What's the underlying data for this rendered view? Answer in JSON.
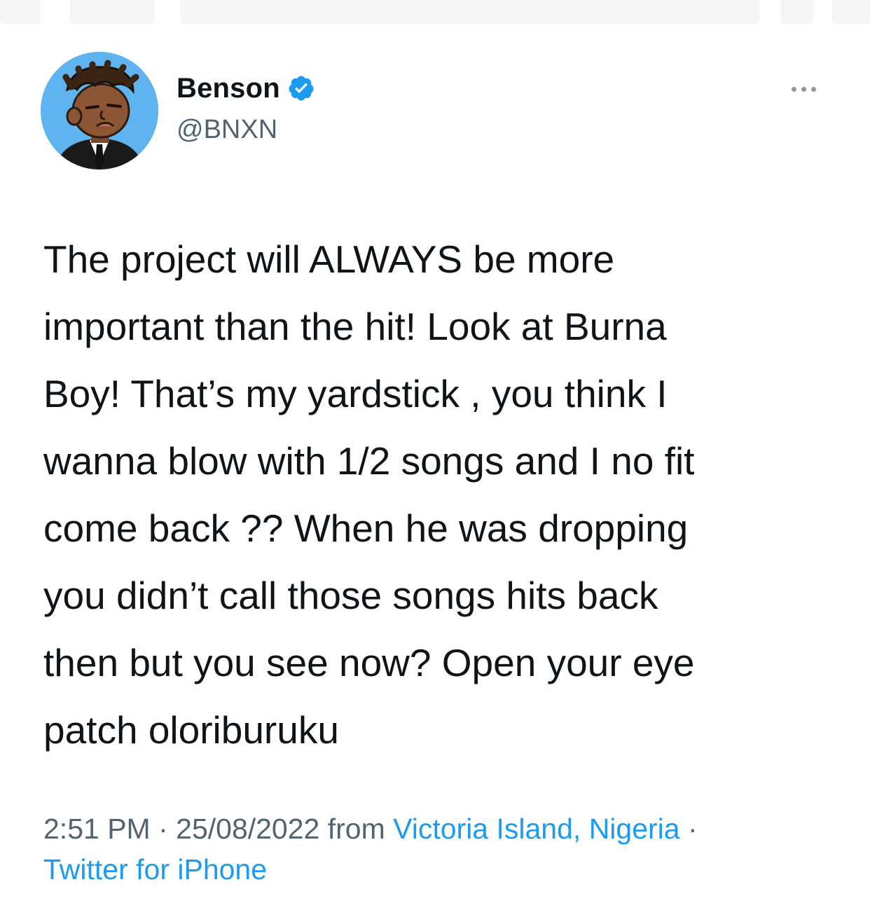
{
  "colors": {
    "text_primary": "#0f1419",
    "text_secondary": "#536471",
    "link": "#1d9bf0",
    "verified": "#1d9bf0",
    "avatar_bg": "#5fb3ee"
  },
  "user": {
    "display_name": "Benson",
    "handle": "@BNXN",
    "verified_icon": "verified-badge-icon",
    "avatar_icon": "cartoon-avatar"
  },
  "tweet": {
    "text": "The project will ALWAYS be more\nimportant than the hit! Look at Burna\nBoy! That’s my yardstick , you think I\nwanna blow with 1/2 songs and I no fit\ncome back ?? When he was dropping\nyou didn’t call those songs hits back\nthen but you see now? Open your eye\npatch oloriburuku"
  },
  "meta": {
    "time": "2:51 PM",
    "separator": " · ",
    "date": "25/08/2022",
    "from_label": " from ",
    "location": "Victoria Island, Nigeria",
    "source": "Twitter for iPhone"
  },
  "more_icon": "more-dots-icon"
}
